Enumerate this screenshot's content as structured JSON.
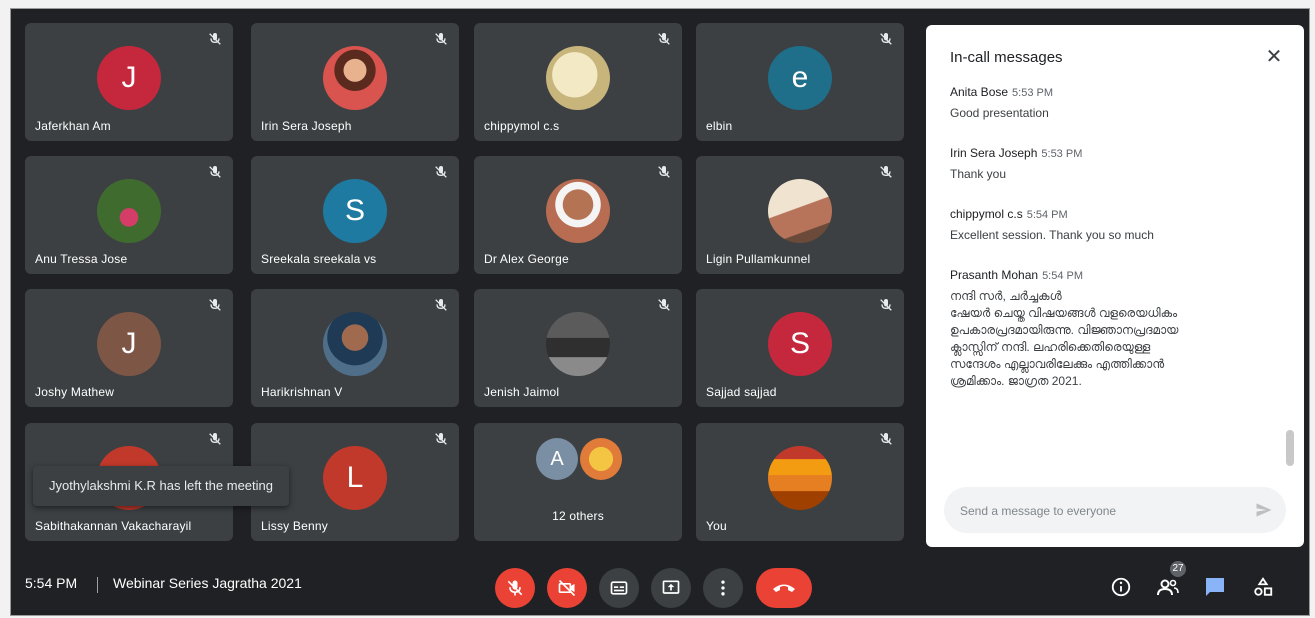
{
  "participants": [
    {
      "name": "Jaferkhan Am",
      "initial": "J",
      "color": "#c5283d",
      "type": "letter"
    },
    {
      "name": "Irin Sera Joseph",
      "type": "photo",
      "photo": "woman-portrait"
    },
    {
      "name": "chippymol c.s",
      "type": "photo",
      "photo": "calligraphy"
    },
    {
      "name": "elbin",
      "initial": "e",
      "color": "#1f6f8b",
      "type": "letter"
    },
    {
      "name": "Anu Tressa Jose",
      "type": "photo",
      "photo": "outdoor-portrait"
    },
    {
      "name": "Sreekala sreekala vs",
      "initial": "S",
      "color": "#1e7aa0",
      "type": "letter"
    },
    {
      "name": "Dr Alex George",
      "type": "photo",
      "photo": "man-portrait"
    },
    {
      "name": "Ligin Pullamkunnel",
      "type": "photo",
      "photo": "landscape"
    },
    {
      "name": "Joshy Mathew",
      "initial": "J",
      "color": "#7d5646",
      "type": "letter"
    },
    {
      "name": "Harikrishnan V",
      "type": "photo",
      "photo": "man-portrait-2"
    },
    {
      "name": "Jenish Jaimol",
      "type": "photo",
      "photo": "group-photo"
    },
    {
      "name": "Sajjad sajjad",
      "initial": "S",
      "color": "#c5283d",
      "type": "letter"
    },
    {
      "name": "Sabithakannan Vakacharayil",
      "initial": "",
      "color": "#c0392b",
      "type": "letter"
    },
    {
      "name": "Lissy Benny",
      "initial": "L",
      "color": "#c0392b",
      "type": "letter"
    },
    {
      "name": "12 others",
      "type": "others",
      "initial": "A",
      "color": "#7a8fa3"
    },
    {
      "name": "You",
      "type": "photo",
      "photo": "sunset"
    }
  ],
  "toast": "Jyothylakshmi K.R has left the meeting",
  "panel": {
    "title": "In-call messages",
    "close_label": "✕",
    "messages": [
      {
        "sender": "Anita Bose",
        "time": "5:53 PM",
        "text": "Good presentation"
      },
      {
        "sender": "Irin Sera Joseph",
        "time": "5:53 PM",
        "text": "Thank you"
      },
      {
        "sender": "chippymol c.s",
        "time": "5:54 PM",
        "text": "Excellent session. Thank you so much"
      },
      {
        "sender": "Prasanth Mohan",
        "time": "5:54 PM",
        "text": "നന്ദി സർ, ചർച്ചകൾ\nഷേയർ ചെയ്ത വിഷയങ്ങൾ വളരെയധികം\nഉപകാരപ്രദമായിരുന്നു. വിജ്ഞാനപ്രദമായ\nക്ലാസ്സിന് നന്ദി. ലഹരിക്കെതിരെയുള്ള\nസന്ദേശം എല്ലാവരിലേക്കും എത്തിക്കാൻ\nശ്രമിക്കാം. ജാഗ്രത 2021."
      }
    ],
    "input_placeholder": "Send a message to everyone"
  },
  "bottombar": {
    "clock": "5:54 PM",
    "meeting_title": "Webinar Series Jagratha 2021",
    "people_count": "27"
  },
  "colors": {
    "background": "#202124",
    "tile": "#3c4043",
    "danger": "#ea4335",
    "accent": "#8ab4f8"
  },
  "icons": {
    "controls": [
      "mic-off-icon",
      "camera-off-icon",
      "captions-icon",
      "present-icon",
      "more-options-icon",
      "end-call-icon"
    ],
    "right": [
      "meeting-details-icon",
      "people-icon",
      "chat-icon",
      "activities-icon"
    ]
  }
}
